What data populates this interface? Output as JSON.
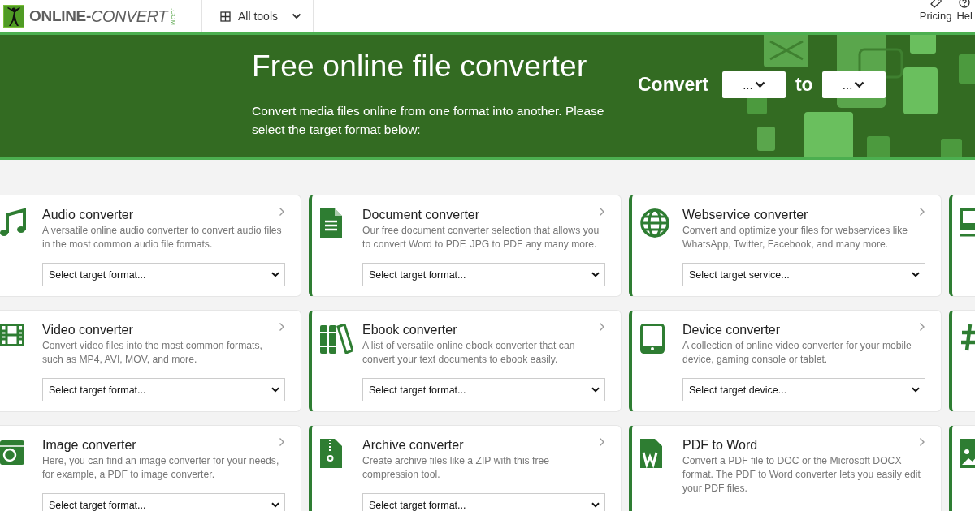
{
  "header": {
    "logo": {
      "main": "ONLINE-",
      "accent": "CONVERT",
      "suffix": ".COM"
    },
    "all_tools": "All tools",
    "links": [
      "Pricing",
      "Hel"
    ]
  },
  "banner": {
    "title": "Free online file converter",
    "subtitle": "Convert media files online from one format into another. Please select the target format below:",
    "convert_label": "Convert",
    "from_value": "...",
    "to_label": "to",
    "to_value": "..."
  },
  "card_rows": [
    [
      {
        "title": "Audio converter",
        "description": "A versatile online audio converter to convert audio files in the most common audio file formats.",
        "select": "Select target format..."
      },
      {
        "title": "Document converter",
        "description": "Our free document converter selection that allows you to convert Word to PDF, JPG to PDF any many more.",
        "select": "Select target format..."
      },
      {
        "title": "Webservice converter",
        "description": "Convert and optimize your files for webservices like WhatsApp, Twitter, Facebook, and many more.",
        "select": "Select target service..."
      }
    ],
    [
      {
        "title": "Video converter",
        "description": "Convert video files into the most common formats, such as MP4, AVI, MOV, and more.",
        "select": "Select target format..."
      },
      {
        "title": "Ebook converter",
        "description": "A list of versatile online ebook converter that can convert your text documents to ebook easily.",
        "select": "Select target format..."
      },
      {
        "title": "Device converter",
        "description": "A collection of online video converter for your mobile device, gaming console or tablet.",
        "select": "Select target device..."
      }
    ],
    [
      {
        "title": "Image converter",
        "description": "Here, you can find an image converter for your needs, for example, a PDF to image converter.",
        "select": "Select target format..."
      },
      {
        "title": "Archive converter",
        "description": "Create archive files like a ZIP with this free compression tool.",
        "select": "Select target format..."
      },
      {
        "title": "PDF to Word",
        "description": "Convert a PDF file to DOC or the Microsoft DOCX format. The PDF to Word converter lets you easily edit your PDF files."
      }
    ]
  ]
}
